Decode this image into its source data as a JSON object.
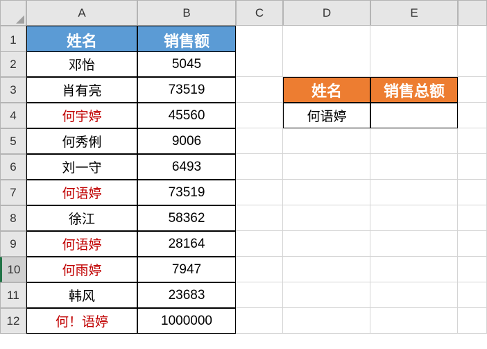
{
  "columns": [
    "A",
    "B",
    "C",
    "D",
    "E"
  ],
  "row_numbers": [
    1,
    2,
    3,
    4,
    5,
    6,
    7,
    8,
    9,
    10,
    11,
    12
  ],
  "selected_row": 10,
  "main_table": {
    "headers": {
      "name": "姓名",
      "sales": "销售额"
    },
    "rows": [
      {
        "name": "邓怡",
        "sales": "5045",
        "red": false
      },
      {
        "name": "肖有亮",
        "sales": "73519",
        "red": false
      },
      {
        "name": "何宇婷",
        "sales": "45560",
        "red": true
      },
      {
        "name": "何秀俐",
        "sales": "9006",
        "red": false
      },
      {
        "name": "刘一守",
        "sales": "6493",
        "red": false
      },
      {
        "name": "何语婷",
        "sales": "73519",
        "red": true
      },
      {
        "name": "徐江",
        "sales": "58362",
        "red": false
      },
      {
        "name": "何语婷",
        "sales": "28164",
        "red": true
      },
      {
        "name": "何雨婷",
        "sales": "7947",
        "red": true
      },
      {
        "name": "韩风",
        "sales": "23683",
        "red": false
      },
      {
        "name": "何！语婷",
        "sales": "1000000",
        "red": true
      }
    ]
  },
  "side_table": {
    "headers": {
      "name": "姓名",
      "total": "销售总额"
    },
    "row": {
      "name": "何语婷",
      "total": ""
    }
  },
  "chart_data": {
    "type": "table",
    "title": "",
    "columns": [
      "姓名",
      "销售额"
    ],
    "rows": [
      [
        "邓怡",
        5045
      ],
      [
        "肖有亮",
        73519
      ],
      [
        "何宇婷",
        45560
      ],
      [
        "何秀俐",
        9006
      ],
      [
        "刘一守",
        6493
      ],
      [
        "何语婷",
        73519
      ],
      [
        "徐江",
        58362
      ],
      [
        "何语婷",
        28164
      ],
      [
        "何雨婷",
        7947
      ],
      [
        "韩风",
        23683
      ],
      [
        "何！语婷",
        1000000
      ]
    ],
    "lookup": {
      "columns": [
        "姓名",
        "销售总额"
      ],
      "rows": [
        [
          "何语婷",
          null
        ]
      ]
    }
  }
}
